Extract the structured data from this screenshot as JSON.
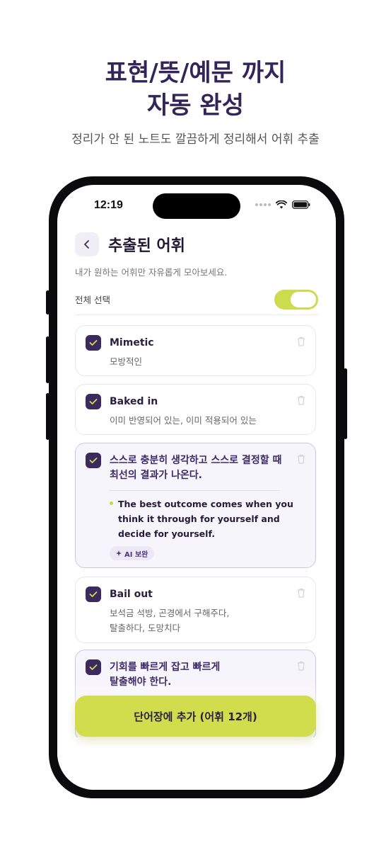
{
  "promo": {
    "headline_line1": "표현/뜻/예문 까지",
    "headline_line2": "자동 완성",
    "subline": "정리가 안 된 노트도 깔끔하게 정리해서 어휘 추출"
  },
  "status_bar": {
    "time": "12:19"
  },
  "screen": {
    "title": "추출된 어휘",
    "description": "내가 원하는 어휘만 자유롭게 모아보세요.",
    "select_all_label": "전체 선택",
    "select_all_on": true
  },
  "cards": [
    {
      "word": "Mimetic",
      "meaning": "모방적인"
    },
    {
      "word": "Baked in",
      "meaning": "이미 반영되어 있는, 이미 적용되어 있는"
    },
    {
      "word_line1": "스스로 충분히 생각하고 스스로 결정할 때",
      "word_line2": "최선의 결과가 나온다.",
      "example_line1": "The best outcome comes when you",
      "example_line2": "think it through for yourself and",
      "example_line3": "decide for yourself.",
      "badge": "AI 보완"
    },
    {
      "word": "Bail out",
      "meaning_line1": "보석금 석방, 곤경에서 구해주다,",
      "meaning_line2": "탈출하다, 도망치다"
    },
    {
      "word_line1": "기회를 빠르게 잡고 빠르게",
      "word_line2": "탈출해야 한다."
    }
  ],
  "cta": {
    "label": "단어장에 추가 (어휘 12개)"
  },
  "colors": {
    "accent": "#d2dd4d",
    "primary": "#3b2a5e"
  }
}
